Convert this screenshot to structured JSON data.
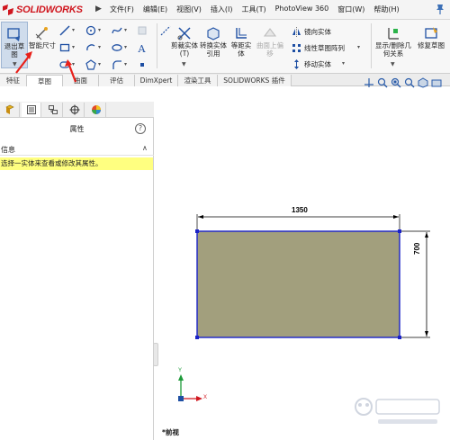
{
  "app": {
    "brand": "SOLIDWORKS",
    "menu": [
      "文件(F)",
      "编辑(E)",
      "视图(V)",
      "插入(I)",
      "工具(T)",
      "PhotoView 360",
      "窗口(W)",
      "帮助(H)"
    ]
  },
  "ribbon": {
    "exit_sketch": "退出草图",
    "smart_dimension": "智能尺寸",
    "trim": "剪裁实体(T)",
    "convert": "转换实体引用",
    "offset": "等距实体",
    "surface_offset": "曲面上偏移",
    "mirror": "镜向实体",
    "linear_pattern": "线性草图阵列",
    "move": "移动实体",
    "display_delete": "显示/删除几何关系",
    "repair": "修复草图"
  },
  "tabs": {
    "items": [
      "特征",
      "草图",
      "曲面",
      "评估",
      "DimXpert",
      "渲染工具",
      "SOLIDWORKS 插件"
    ],
    "active_index": 1
  },
  "property_panel": {
    "title": "属性",
    "section_title": "信息",
    "message": "选择一实体来查看或修改其属性。"
  },
  "graphics": {
    "dimension_width": "1350",
    "dimension_height": "700",
    "view_name": "*前视",
    "axis_x": "X",
    "axis_y": "Y"
  },
  "colors": {
    "accent": "#d0161e",
    "rect_fill": "#a29f7d",
    "rect_edge": "#1a22c8",
    "message_bg": "#ffff80",
    "annotation": "#e8201a"
  }
}
